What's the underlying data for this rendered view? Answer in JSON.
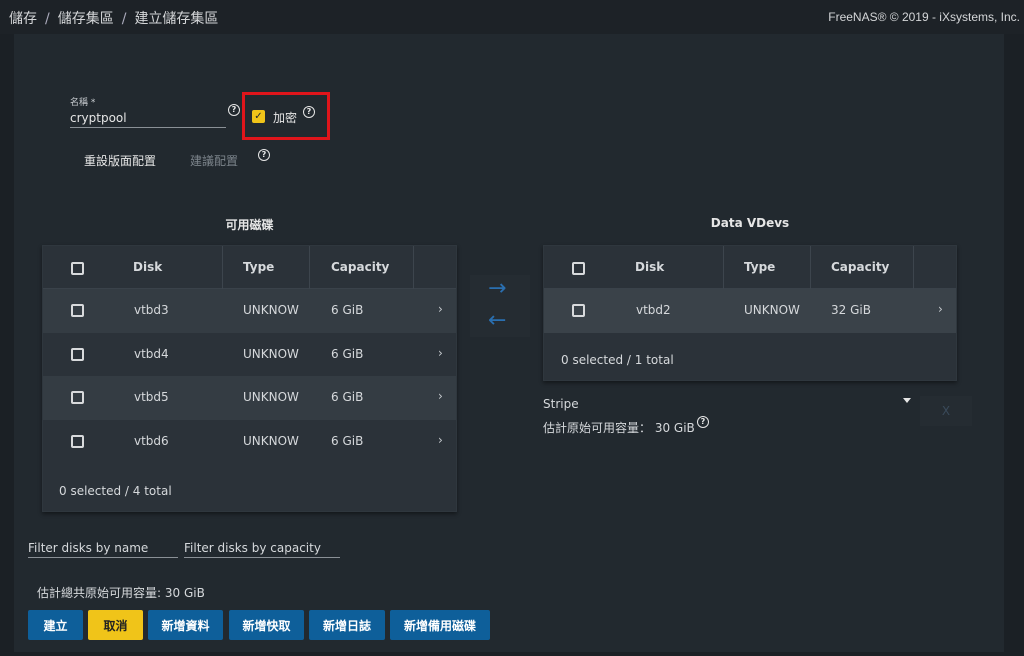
{
  "breadcrumb": {
    "items": [
      "儲存",
      "儲存集區",
      "建立儲存集區"
    ]
  },
  "copyright": "FreeNAS® © 2019 - iXsystems, Inc.",
  "form": {
    "name_label": "名稱 *",
    "name_value": "cryptpool",
    "encryption_label": "加密",
    "encryption_checked": true,
    "reset_layout_label": "重設版面配置",
    "suggest_layout_label": "建議配置"
  },
  "available": {
    "title": "可用磁碟",
    "columns": [
      "Disk",
      "Type",
      "Capacity"
    ],
    "rows": [
      {
        "disk": "vtbd3",
        "type": "UNKNOW",
        "capacity": "6 GiB"
      },
      {
        "disk": "vtbd4",
        "type": "UNKNOW",
        "capacity": "6 GiB"
      },
      {
        "disk": "vtbd5",
        "type": "UNKNOW",
        "capacity": "6 GiB"
      },
      {
        "disk": "vtbd6",
        "type": "UNKNOW",
        "capacity": "6 GiB"
      }
    ],
    "footer": "0 selected / 4 total"
  },
  "vdevs": {
    "title": "Data VDevs",
    "columns": [
      "Disk",
      "Type",
      "Capacity"
    ],
    "rows": [
      {
        "disk": "vtbd2",
        "type": "UNKNOW",
        "capacity": "32 GiB"
      }
    ],
    "footer": "0 selected / 1 total",
    "layout_value": "Stripe",
    "remove_label": "X",
    "estimated_label": "估計原始可用容量： 30 GiB"
  },
  "filters": {
    "name_placeholder": "Filter disks by name",
    "capacity_placeholder": "Filter disks by capacity"
  },
  "estimated_total": "估計總共原始可用容量: 30 GiB",
  "buttons": {
    "create": "建立",
    "cancel": "取消",
    "add_data": "新增資料",
    "add_cache": "新增快取",
    "add_log": "新增日誌",
    "add_spare": "新增備用磁碟"
  },
  "icons": {
    "help": "help-circle-icon",
    "arrow_right": "arrow-right-icon",
    "arrow_left": "arrow-left-icon",
    "chevron": "chevron-right-icon",
    "caret": "caret-down-icon"
  },
  "colors": {
    "background": "#1b2025",
    "card": "#22292f",
    "accent_blue": "#0e5f9a",
    "accent_yellow": "#f0c419",
    "highlight_red": "#e0151b"
  }
}
